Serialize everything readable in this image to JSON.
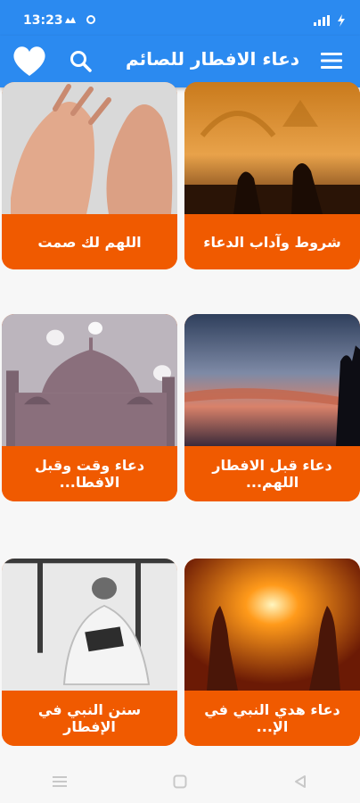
{
  "status_bar": {
    "time": "13:23"
  },
  "app_bar": {
    "title": "دعاء الافطار للصائم",
    "colors": {
      "background": "#2b8af0",
      "icons": "#ffffff"
    },
    "icons": [
      "heart-icon",
      "search-icon",
      "menu-icon"
    ]
  },
  "cards": [
    {
      "caption": "شروط وآداب الدعاء",
      "image": "silhouettes-praying-at-sunset"
    },
    {
      "caption": "اللهم لك صمت",
      "image": "hands-raised-in-prayer"
    },
    {
      "caption": "دعاء قبل الافطار اللهم...",
      "image": "silhouette-praying-on-cliff-at-dusk"
    },
    {
      "caption": "دعاء وقت وقبل الافطا...",
      "image": "mosque-domes-with-lights"
    },
    {
      "caption": "دعاء هدي النبي في الإ...",
      "image": "hands-raised-towards-sun"
    },
    {
      "caption": "سنن النبي في الإفطار",
      "image": "man-reading-quran"
    }
  ],
  "theme": {
    "card_caption_bg": "#f05a00",
    "page_bg": "#f7f7f7"
  },
  "nav_bar": {
    "icons": [
      "recent-apps-icon",
      "home-icon",
      "back-icon"
    ]
  }
}
